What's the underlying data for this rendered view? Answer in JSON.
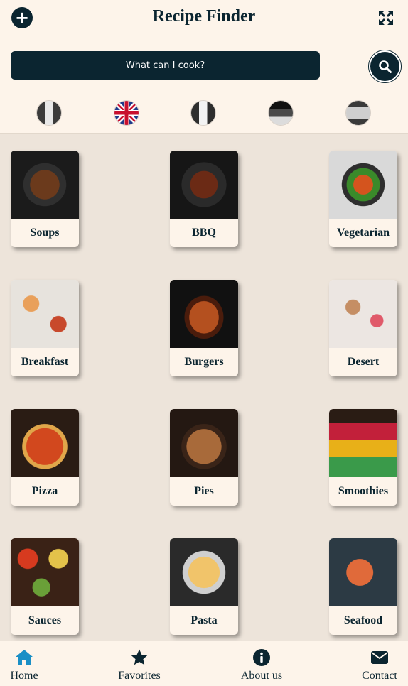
{
  "header": {
    "title": "Recipe Finder",
    "add_icon": "plus-circle-icon",
    "expand_icon": "expand-arrows-icon",
    "search_icon": "search-icon"
  },
  "search": {
    "button_label": "What can I cook?"
  },
  "languages": [
    {
      "name": "italian-flag"
    },
    {
      "name": "uk-flag"
    },
    {
      "name": "french-flag"
    },
    {
      "name": "german-flag"
    },
    {
      "name": "spanish-flag"
    }
  ],
  "categories": [
    {
      "label": "Soups"
    },
    {
      "label": "BBQ"
    },
    {
      "label": "Vegetarian"
    },
    {
      "label": "Breakfast"
    },
    {
      "label": "Burgers"
    },
    {
      "label": "Desert"
    },
    {
      "label": "Pizza"
    },
    {
      "label": "Pies"
    },
    {
      "label": "Smoothies"
    },
    {
      "label": "Sauces"
    },
    {
      "label": "Pasta"
    },
    {
      "label": "Seafood"
    }
  ],
  "nav": {
    "home": "Home",
    "favorites": "Favorites",
    "about": "About us",
    "contact": "Contact",
    "active": "home",
    "active_color": "#1a8fc6"
  },
  "colors": {
    "primary": "#0b2530",
    "background": "#ede4da",
    "surface": "#fdf4ea"
  }
}
